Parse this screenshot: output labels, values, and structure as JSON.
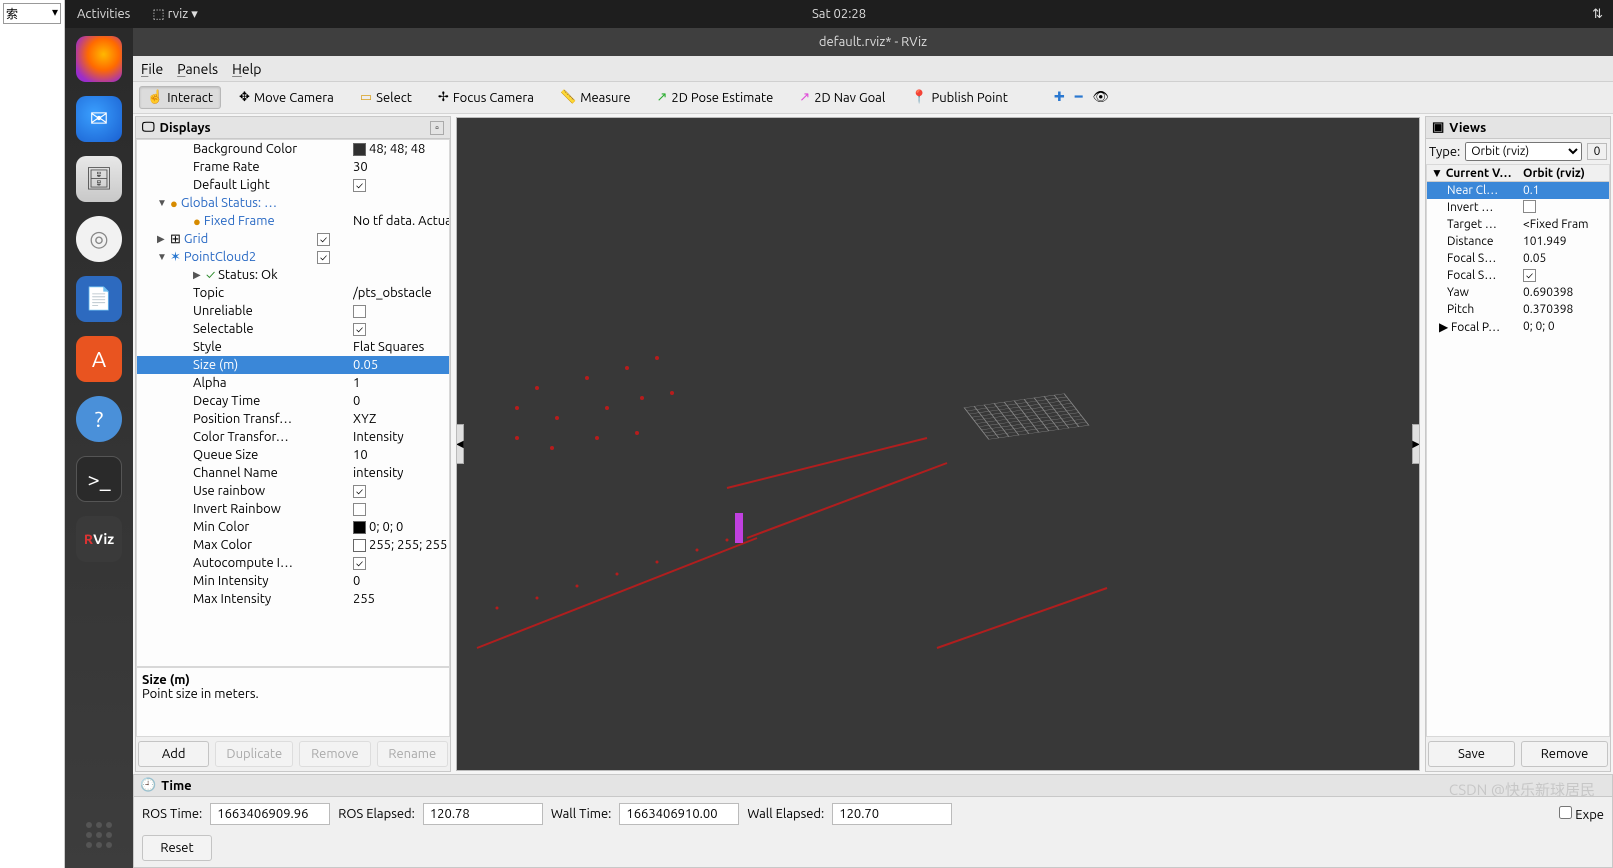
{
  "leftRemnant": {
    "text": "索",
    "arrow": "▾"
  },
  "topbar": {
    "activities": "Activities",
    "appmenu": "rviz ▾",
    "clock": "Sat 02:28",
    "trayIcon": "network-icon"
  },
  "dock": {
    "rviz_label": "RViz"
  },
  "window": {
    "title": "default.rviz* - RViz"
  },
  "menubar": {
    "file": "File",
    "panels": "Panels",
    "help": "Help"
  },
  "toolbar": {
    "interact": "Interact",
    "move": "Move Camera",
    "select": "Select",
    "focus": "Focus Camera",
    "measure": "Measure",
    "pose": "2D Pose Estimate",
    "nav": "2D Nav Goal",
    "publish": "Publish Point"
  },
  "displays": {
    "title": "Displays",
    "bg_label": "Background Color",
    "bg_val": "48; 48; 48",
    "fr_label": "Frame Rate",
    "fr_val": "30",
    "dl_label": "Default Light",
    "gs_label": "Global Status: …",
    "ff_label": "Fixed Frame",
    "ff_val": "No tf data.  Actual e…",
    "grid_label": "Grid",
    "pc_label": "PointCloud2",
    "st_label": "Status: Ok",
    "topic_label": "Topic",
    "topic_val": "/pts_obstacle",
    "unrel_label": "Unreliable",
    "selec_label": "Selectable",
    "style_label": "Style",
    "style_val": "Flat Squares",
    "size_label": "Size (m)",
    "size_val": "0.05",
    "alpha_label": "Alpha",
    "alpha_val": "1",
    "decay_label": "Decay Time",
    "decay_val": "0",
    "ptrans_label": "Position Transf…",
    "ptrans_val": "XYZ",
    "ctrans_label": "Color Transfor…",
    "ctrans_val": "Intensity",
    "queue_label": "Queue Size",
    "queue_val": "10",
    "chan_label": "Channel Name",
    "chan_val": "intensity",
    "urain_label": "Use rainbow",
    "irain_label": "Invert Rainbow",
    "minc_label": "Min Color",
    "minc_val": "0; 0; 0",
    "maxc_label": "Max Color",
    "maxc_val": "255; 255; 255",
    "autoi_label": "Autocompute I…",
    "mini_label": "Min Intensity",
    "mini_val": "0",
    "maxi_label": "Max Intensity",
    "maxi_val": "255"
  },
  "desc": {
    "title": "Size (m)",
    "body": "Point size in meters."
  },
  "buttons": {
    "add": "Add",
    "dup": "Duplicate",
    "rem": "Remove",
    "ren": "Rename"
  },
  "views": {
    "title": "Views",
    "type_label": "Type:",
    "type_val": "Orbit (rviz)",
    "zero": "0",
    "hdr1": "Current V…",
    "hdr2": "Orbit (rviz)",
    "near_l": "Near Cl…",
    "near_v": "0.1",
    "inv_l": "Invert …",
    "tgt_l": "Target …",
    "tgt_v": "<Fixed Fram",
    "dist_l": "Distance",
    "dist_v": "101.949",
    "fsz_l": "Focal S…",
    "fsz_v": "0.05",
    "fsf_l": "Focal S…",
    "yaw_l": "Yaw",
    "yaw_v": "0.690398",
    "pit_l": "Pitch",
    "pit_v": "0.370398",
    "fp_l": "Focal P…",
    "fp_v": "0; 0; 0",
    "save": "Save",
    "remove": "Remove"
  },
  "time": {
    "title": "Time",
    "ros_time_l": "ROS Time:",
    "ros_time_v": "1663406909.96",
    "ros_elap_l": "ROS Elapsed:",
    "ros_elap_v": "120.78",
    "wall_time_l": "Wall Time:",
    "wall_time_v": "1663406910.00",
    "wall_elap_l": "Wall Elapsed:",
    "wall_elap_v": "120.70",
    "exp": "Expe",
    "reset": "Reset"
  },
  "watermark": "CSDN @快乐新球居民"
}
